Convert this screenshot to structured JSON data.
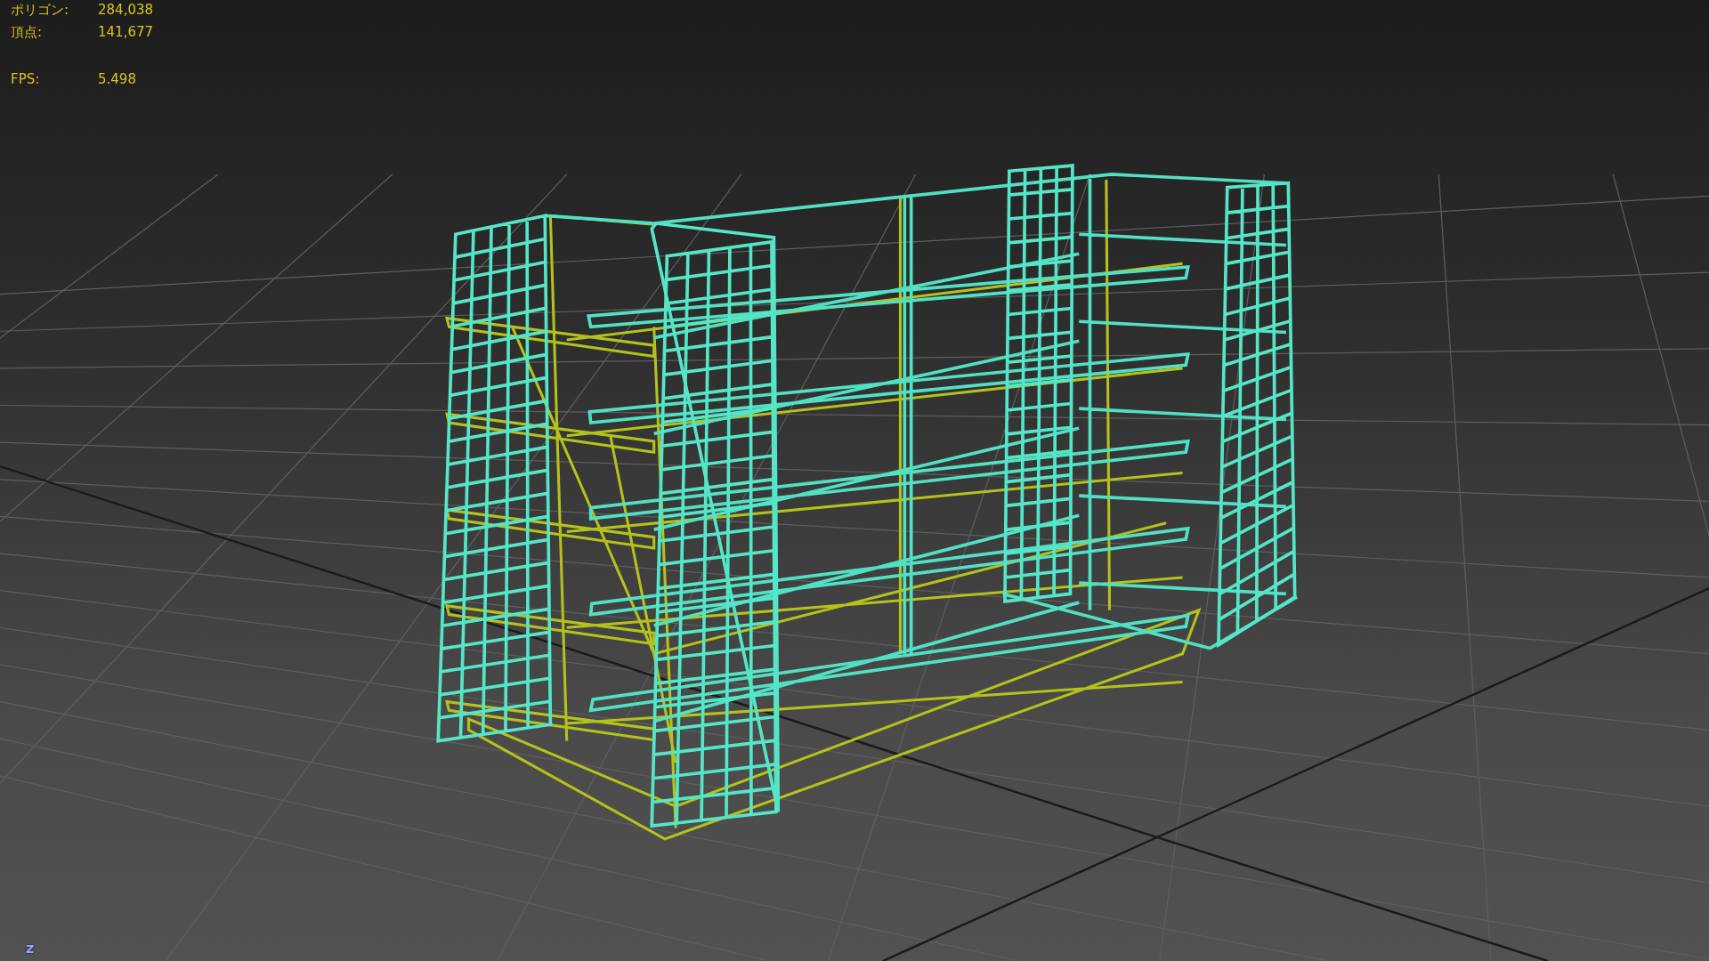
{
  "scene_stats": [
    {
      "label": "ポリゴン:",
      "value": "284,038"
    },
    {
      "label": "頂点:",
      "value": "141,677"
    }
  ],
  "fps": {
    "label": "FPS:",
    "value": "5.498"
  },
  "axis_label": "z"
}
